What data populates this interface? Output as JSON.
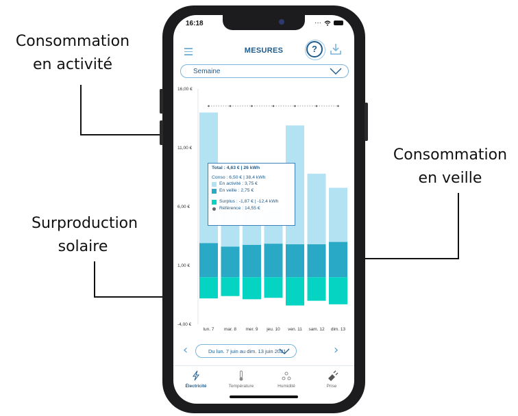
{
  "callouts": {
    "activite": [
      "Consommation",
      "en activité"
    ],
    "veille": [
      "Consommation",
      "en veille"
    ],
    "surproduction": [
      "Surproduction",
      "solaire"
    ]
  },
  "status": {
    "time": "16:18"
  },
  "header": {
    "title": "MESURES",
    "help_label": "?"
  },
  "period": {
    "selected": "Semaine"
  },
  "tooltip": {
    "total": "Total : 4,63 € | 26 kWh",
    "conso": "Conso : 6,50 € | 38,4 kWh",
    "activite": "En activité : 3,75 €",
    "veille": "En veille : 2,75 €",
    "surplus": "Surplus : -1,87 € | -12,4 kWh",
    "reference": "Référence : 14,55 €"
  },
  "range": {
    "label": "Du lun. 7 juin au dim. 13 juin 2021",
    "prev": "‹",
    "next": "›"
  },
  "tabs": [
    {
      "label": "Électricité",
      "icon": "lightning-icon",
      "active": true
    },
    {
      "label": "Température",
      "icon": "thermometer-icon",
      "active": false
    },
    {
      "label": "Humidité",
      "icon": "droplets-icon",
      "active": false
    },
    {
      "label": "Prise",
      "icon": "plug-icon",
      "active": false
    }
  ],
  "colors": {
    "activite": "#b3e3f3",
    "veille": "#2aa9c6",
    "surplus": "#06d4c3",
    "reference": "#666666",
    "accent": "#1d5b8e"
  },
  "chart_data": {
    "type": "bar",
    "stacked": true,
    "categories": [
      "lun. 7",
      "mar. 8",
      "mer. 9",
      "jeu. 10",
      "ven. 11",
      "sam. 12",
      "dim. 13"
    ],
    "y_ticks": [
      "16,00 €",
      "11,00 €",
      "6,00 €",
      "1,00 €",
      "-4,00 €"
    ],
    "ylim": [
      -4,
      16
    ],
    "series": [
      {
        "name": "En veille",
        "values": [
          2.9,
          2.6,
          2.75,
          2.85,
          2.8,
          2.8,
          3.0
        ]
      },
      {
        "name": "En activité",
        "values": [
          11.1,
          6.9,
          3.75,
          2.9,
          10.1,
          6.0,
          4.6
        ]
      },
      {
        "name": "Surplus",
        "values": [
          -1.8,
          -1.6,
          -1.87,
          -1.75,
          -2.4,
          -2.0,
          -2.3
        ]
      },
      {
        "name": "Référence",
        "values": [
          14.55,
          14.55,
          14.55,
          14.55,
          14.55,
          14.55,
          14.55
        ]
      }
    ],
    "grid": false
  }
}
